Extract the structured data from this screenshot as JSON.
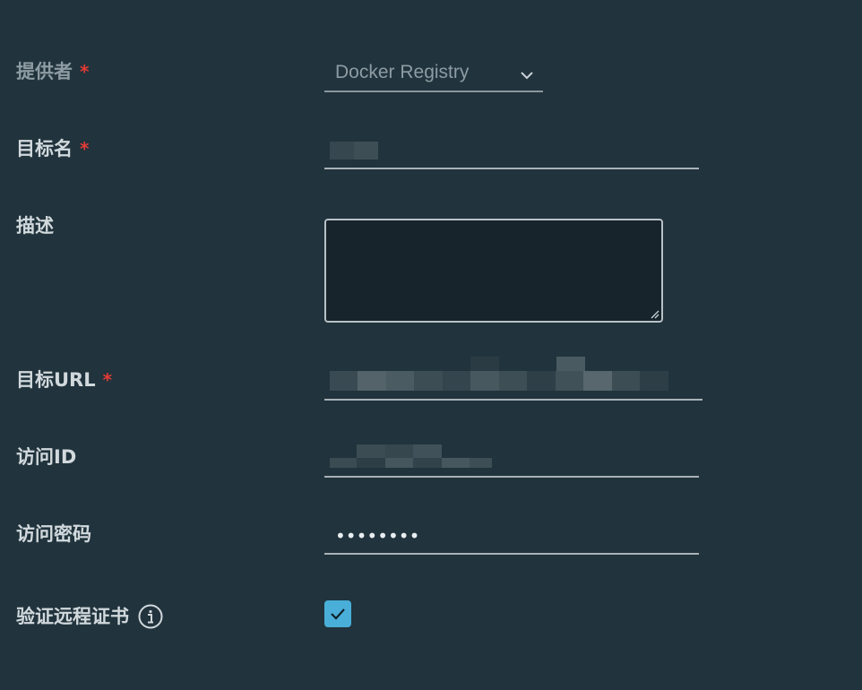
{
  "form": {
    "provider": {
      "label": "提供者",
      "required_mark": "*",
      "value": "Docker Registry",
      "icon": "chevron-down-icon"
    },
    "target_name": {
      "label": "目标名",
      "required_mark": "*"
    },
    "description": {
      "label": "描述"
    },
    "target_url": {
      "label": "目标URL",
      "required_mark": "*"
    },
    "access_id": {
      "label": "访问ID"
    },
    "access_secret": {
      "label": "访问密码",
      "value": "••••••••"
    },
    "verify_cert": {
      "label": "验证远程证书",
      "checked": true,
      "icon": "info-icon"
    }
  },
  "colors": {
    "background": "#21333c",
    "label": "#d1d9dd",
    "required": "#e23a35",
    "checkbox": "#49afd9"
  }
}
